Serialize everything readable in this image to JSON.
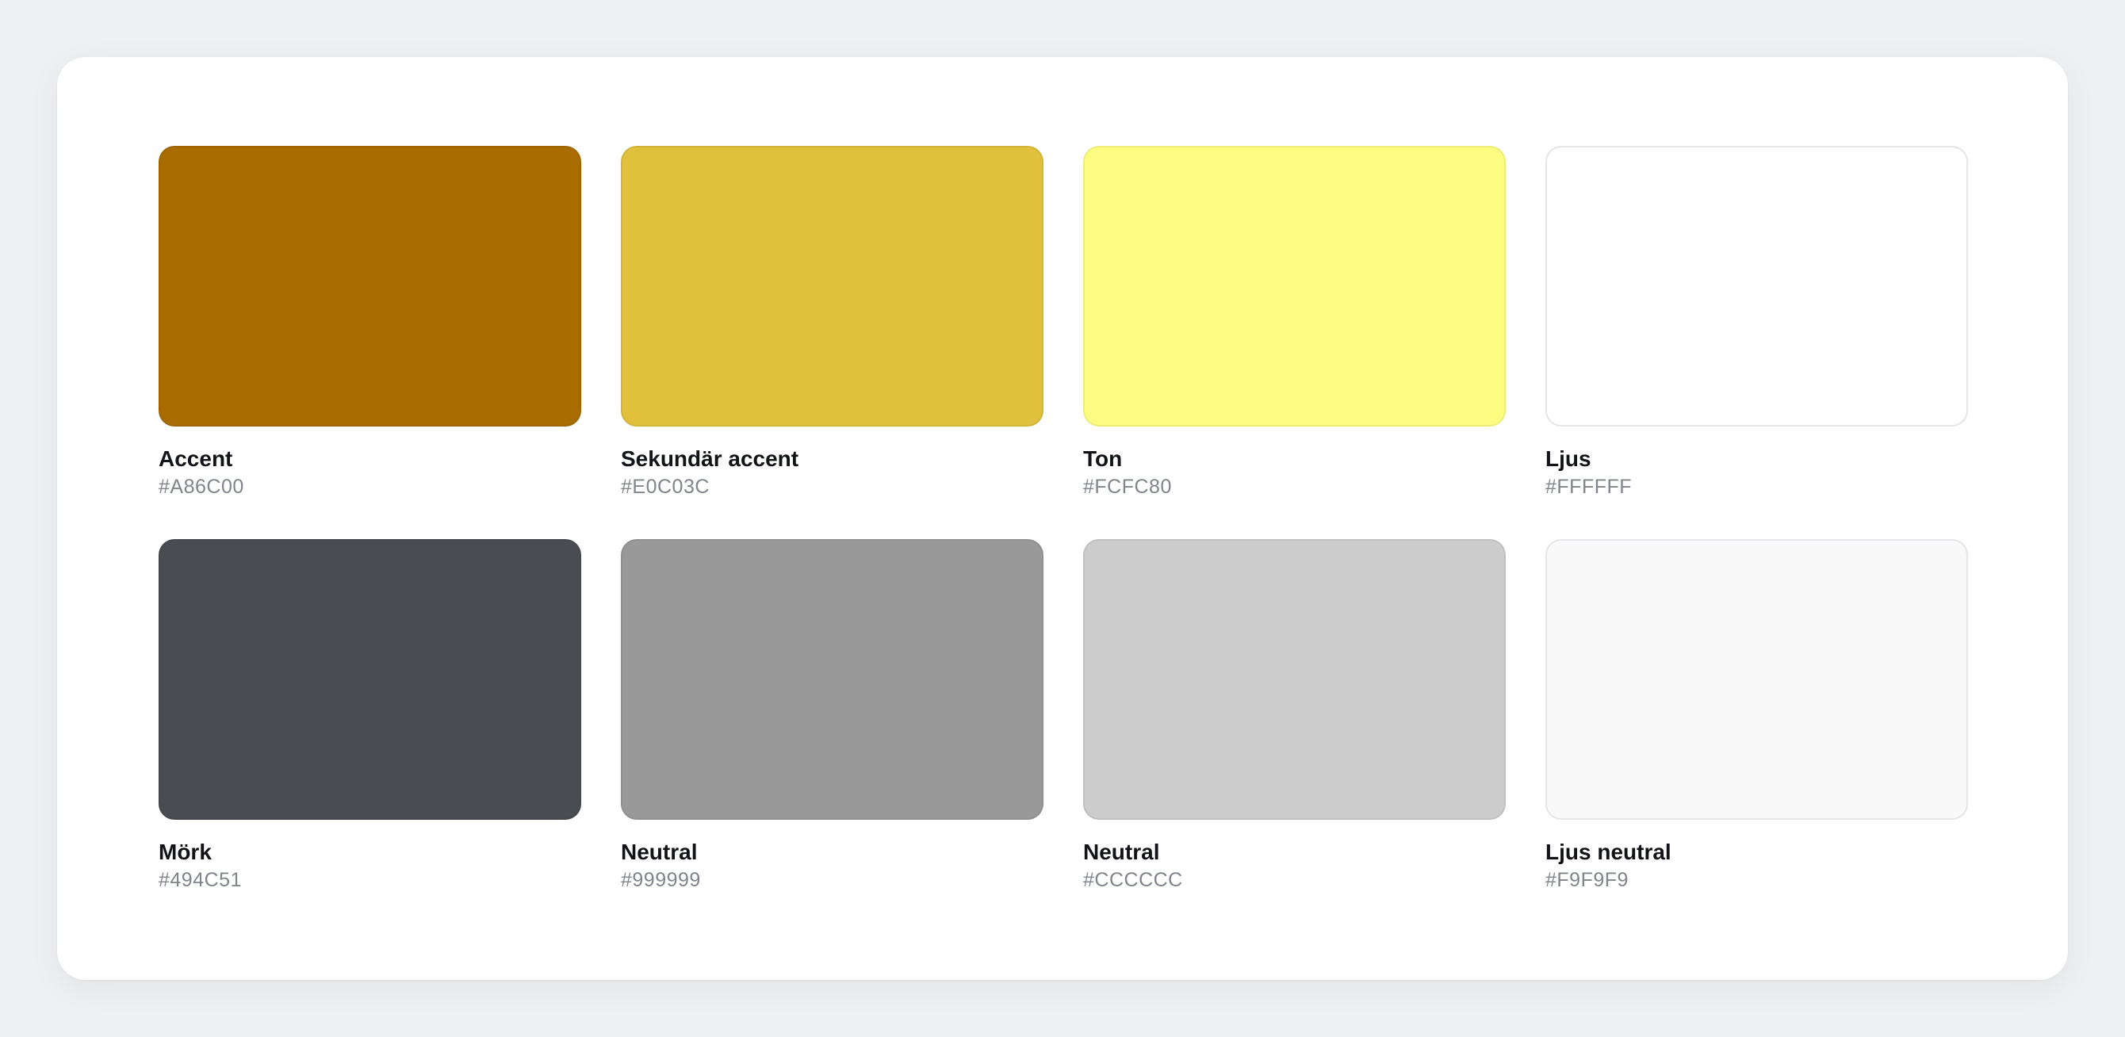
{
  "swatches": [
    {
      "label": "Accent",
      "hex": "#A86C00",
      "color": "#A86C00"
    },
    {
      "label": "Sekundär accent",
      "hex": "#E0C03C",
      "color": "#E0C03C"
    },
    {
      "label": "Ton",
      "hex": "#FCFC80",
      "color": "#FCFC80"
    },
    {
      "label": "Ljus",
      "hex": "#FFFFFF",
      "color": "#FFFFFF"
    },
    {
      "label": "Mörk",
      "hex": "#494C51",
      "color": "#494C51"
    },
    {
      "label": "Neutral",
      "hex": "#999999",
      "color": "#999999"
    },
    {
      "label": "Neutral",
      "hex": "#CCCCCC",
      "color": "#CCCCCC"
    },
    {
      "label": "Ljus neutral",
      "hex": "#F9F9F9",
      "color": "#F9F9F9"
    }
  ]
}
